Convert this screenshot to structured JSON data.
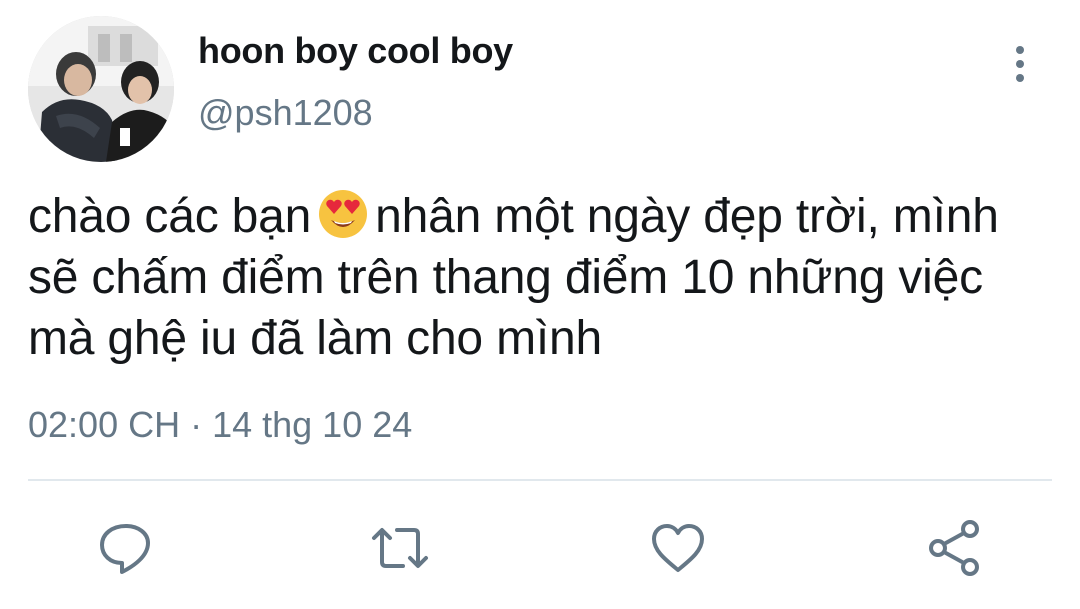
{
  "tweet": {
    "display_name": "hoon boy cool boy",
    "handle": "@psh1208",
    "text_lines": [
      {
        "before": "chào các bạn",
        "after": "nhân một ngày đẹp trời, mình"
      },
      {
        "text": "sẽ chấm điểm trên thang điểm 10 những việc"
      },
      {
        "text": "mà ghệ iu đã làm cho mình"
      }
    ],
    "inline_emoji": "heart-eyes-emoji",
    "timestamp": "02:00 CH · 14 thg 10 24",
    "avatar_icon": "profile-photo-two-people",
    "more_icon": "vertical-ellipsis-icon"
  },
  "actions": {
    "reply_icon": "reply-icon",
    "retweet_icon": "retweet-icon",
    "like_icon": "like-icon",
    "share_icon": "share-icon"
  },
  "colors": {
    "text_primary": "#14171a",
    "text_secondary": "#657786",
    "divider": "#e1e8ed",
    "icon": "#657786"
  }
}
